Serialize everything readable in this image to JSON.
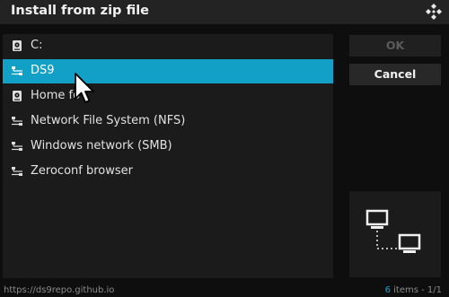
{
  "dialog": {
    "title": "Install from zip file"
  },
  "list": {
    "items": [
      {
        "label": "C:",
        "icon": "hard-drive-icon",
        "selected": false
      },
      {
        "label": "DS9",
        "icon": "network-share-icon",
        "selected": true
      },
      {
        "label": "Home fo",
        "icon": "hard-drive-icon",
        "selected": false
      },
      {
        "label": "Network File System (NFS)",
        "icon": "network-share-icon",
        "selected": false
      },
      {
        "label": "Windows network (SMB)",
        "icon": "network-share-icon",
        "selected": false
      },
      {
        "label": "Zeroconf browser",
        "icon": "network-share-icon",
        "selected": false
      }
    ]
  },
  "buttons": {
    "ok_label": "OK",
    "cancel_label": "Cancel"
  },
  "footer": {
    "path": "https://ds9repo.github.io",
    "count_num": "6",
    "count_text": " items - 1/1"
  },
  "colors": {
    "accent": "#12a0c7",
    "panel": "#1b1b1b",
    "titlebar": "#232323"
  }
}
